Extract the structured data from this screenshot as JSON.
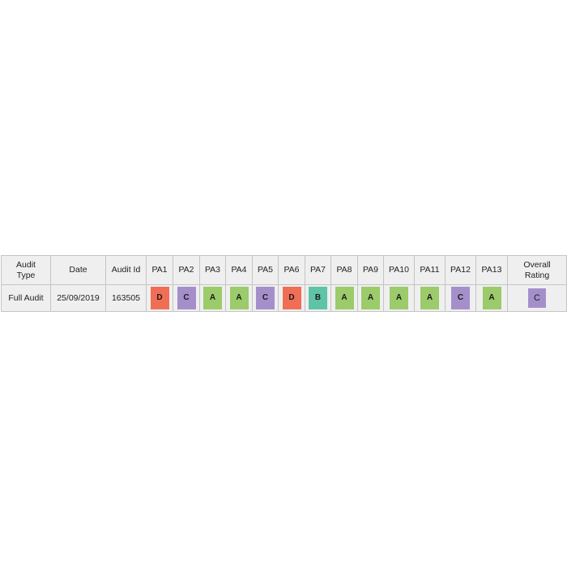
{
  "table": {
    "headers": {
      "audit_type": "Audit\nType",
      "date": "Date",
      "audit_id": "Audit Id",
      "pa": [
        "PA1",
        "PA2",
        "PA3",
        "PA4",
        "PA5",
        "PA6",
        "PA7",
        "PA8",
        "PA9",
        "PA10",
        "PA11",
        "PA12",
        "PA13"
      ],
      "overall": "Overall\nRating"
    },
    "header_audit_type_lines": [
      "Audit",
      "Type"
    ],
    "header_overall_lines": [
      "Overall",
      "Rating"
    ],
    "row": {
      "audit_type": "Full Audit",
      "date": "25/09/2019",
      "audit_id": "163505",
      "pa_ratings": [
        "D",
        "C",
        "A",
        "A",
        "C",
        "D",
        "B",
        "A",
        "A",
        "A",
        "A",
        "C",
        "A"
      ],
      "overall_rating": "C"
    }
  },
  "rating_colors": {
    "A": "#9bcb6a",
    "B": "#5fc3a8",
    "C": "#a58fcb",
    "D": "#ef6e55"
  }
}
